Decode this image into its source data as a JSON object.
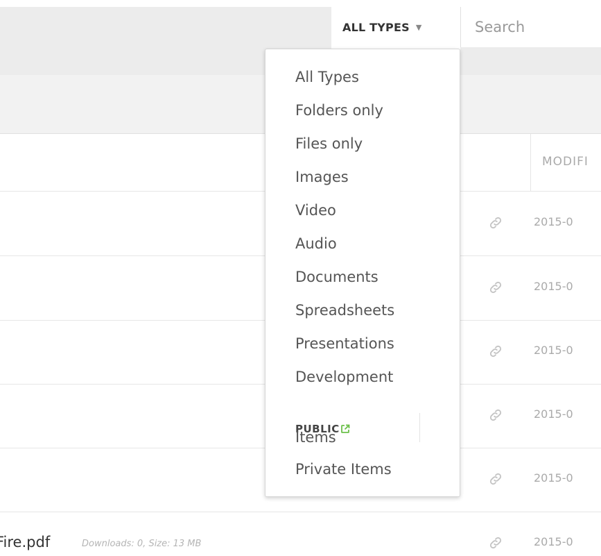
{
  "toolbar": {
    "type_filter_label": "ALL TYPES",
    "search_placeholder": "Search"
  },
  "table": {
    "modified_header": "MODIFI",
    "rows": [
      {
        "date": "2015-0"
      },
      {
        "date": "2015-0"
      },
      {
        "date": "2015-0"
      },
      {
        "date": "2015-0"
      },
      {
        "date": "2015-0"
      },
      {
        "filename": "Fire.pdf",
        "meta": "Downloads: 0, Size: 13 MB",
        "date": "2015-0"
      }
    ]
  },
  "dropdown": {
    "items": [
      "All Types",
      "Folders only",
      "Files only",
      "Images",
      "Video",
      "Audio",
      "Documents",
      "Spreadsheets",
      "Presentations",
      "Development"
    ],
    "public_heading": "PUBLIC",
    "public_items": [
      "Items",
      "Private Items"
    ]
  },
  "colors": {
    "public_icon": "#6cc04a",
    "link_icon": "#c4c4c4",
    "toolbar_bg": "#ececec"
  },
  "icons": {
    "filter_caret": "caret-down-icon",
    "row_link": "link-icon",
    "public_external": "external-link-icon"
  }
}
